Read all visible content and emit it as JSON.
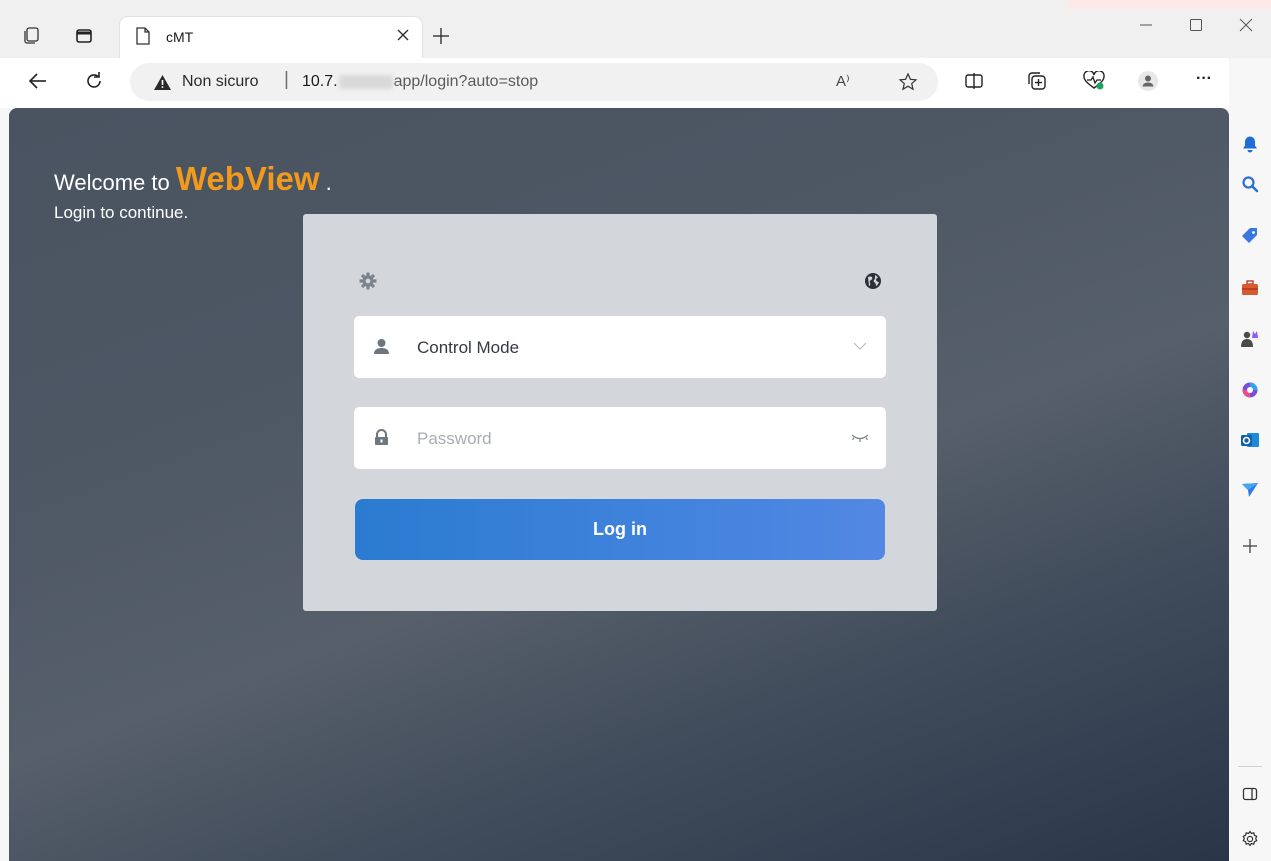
{
  "browser": {
    "tab": {
      "title": "cMT"
    },
    "address": {
      "security_label": "Non sicuro",
      "separator": "|",
      "host_visible": "10.7.",
      "path": "app/login?auto=stop"
    },
    "read_aloud_label": "A⁾",
    "more_label": "···"
  },
  "page": {
    "welcome_prefix": "Welcome to",
    "brand": "WebView",
    "welcome_suffix": ".",
    "subtitle": "Login to continue.",
    "login_card": {
      "mode_value": "Control Mode",
      "password_placeholder": "Password",
      "login_button": "Log in"
    }
  },
  "colors": {
    "brand": "#f39a1d",
    "button_start": "#2a7bd1",
    "button_end": "#5288e4",
    "card_bg": "#d3d6da"
  }
}
